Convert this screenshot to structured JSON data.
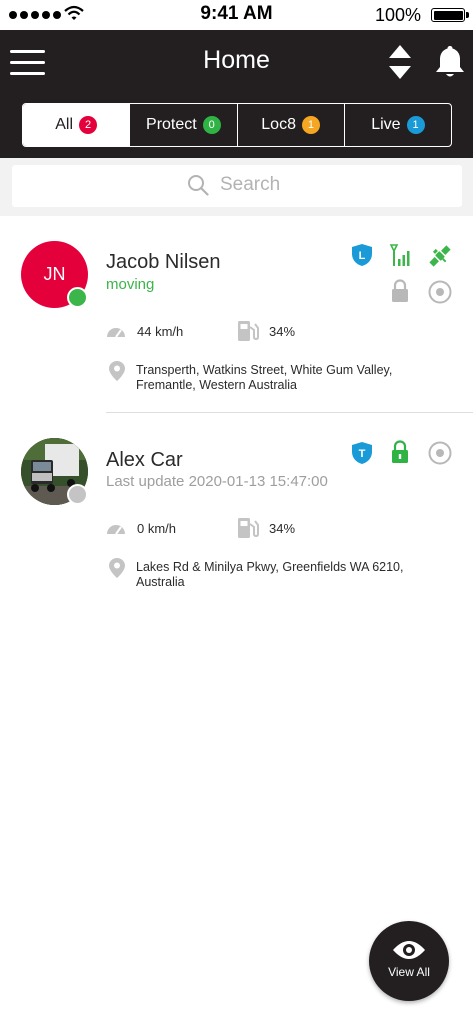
{
  "status_bar": {
    "time": "9:41 AM",
    "battery": "100%"
  },
  "header": {
    "title": "Home"
  },
  "tabs": [
    {
      "label": "All",
      "count": "2",
      "color": "#e4003b",
      "active": true
    },
    {
      "label": "Protect",
      "count": "0",
      "color": "#2fb344"
    },
    {
      "label": "Loc8",
      "count": "1",
      "color": "#f5a623"
    },
    {
      "label": "Live",
      "count": "1",
      "color": "#1a9ad6"
    }
  ],
  "search": {
    "placeholder": "Search"
  },
  "vehicles": [
    {
      "initials": "JN",
      "name": "Jacob Nilsen",
      "status": "moving",
      "speed": "44 km/h",
      "fuel": "34%",
      "address": "Transperth, Watkins Street, White Gum Valley, Fremantle, Western Australia",
      "badge": "L"
    },
    {
      "name": "Alex Car",
      "status": "Last update 2020-01-13 15:47:00",
      "speed": "0 km/h",
      "fuel": "34%",
      "address": "Lakes Rd & Minilya Pkwy, Greenfields WA 6210, Australia",
      "badge": "T"
    }
  ],
  "fab": {
    "label": "View All"
  },
  "colors": {
    "header_bg": "#231f20",
    "accent_red": "#e4003b",
    "green": "#2fb344",
    "blue": "#1a9ad6",
    "orange": "#f5a623",
    "grey_icon": "#b8b8b8"
  }
}
